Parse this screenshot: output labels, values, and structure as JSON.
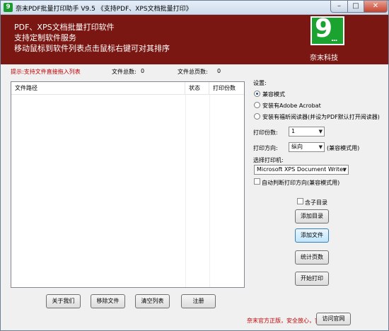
{
  "window": {
    "title": "奈末PDF批量打印助手 V9.5  《支持PDF、XPS文档批量打印》",
    "min_glyph": "–",
    "max_glyph": "□",
    "close_glyph": "✕"
  },
  "banner": {
    "line1": "PDF、XPS文档批量打印软件",
    "line2": "支持定制软件服务",
    "line3": "移动鼠标到软件列表点击鼠标右键可对其排序",
    "logo_text": "9",
    "logo_dots": "...",
    "company": "奈末科技",
    "background_color": "#7b1712",
    "logo_color": "#1aa32f"
  },
  "status": {
    "hint": "提示:支持文件直接拖入列表",
    "total_files_label": "文件总数:",
    "total_files_value": "0",
    "total_pages_label": "文件总页数:",
    "total_pages_value": "0"
  },
  "file_list": {
    "columns": [
      "文件路径",
      "状态",
      "打印份数"
    ],
    "rows": []
  },
  "settings": {
    "heading": "设置:",
    "modes": [
      {
        "label": "兼容模式",
        "selected": true
      },
      {
        "label": "安装有Adobe Acrobat",
        "selected": false
      },
      {
        "label": "安装有福昕阅读器(并设为PDF默认打开阅读器)",
        "selected": false
      }
    ],
    "copies_label": "打印份数:",
    "copies_value": "1",
    "orientation_label": "打印方向:",
    "orientation_value": "纵向",
    "orientation_note": "(兼容模式用)",
    "printer_label": "选择打印机:",
    "printer_value": "Microsoft XPS Document Writer",
    "auto_orientation_label": "自动判断打印方向(兼容模式用)",
    "auto_orientation_checked": false,
    "dropdown_glyph": "▼"
  },
  "actions": {
    "include_subdir_label": "含子目录",
    "include_subdir_checked": false,
    "add_folder": "添加目录",
    "add_file": "添加文件",
    "count_pages": "统计页数",
    "start_print": "开始打印"
  },
  "bottom_buttons": {
    "about": "关于我们",
    "remove_file": "移除文件",
    "clear_list": "清空列表",
    "register": "注册"
  },
  "footer": {
    "note": "奈末官方正版，安全放心，官方下载-->",
    "visit_site": "访问官网"
  }
}
